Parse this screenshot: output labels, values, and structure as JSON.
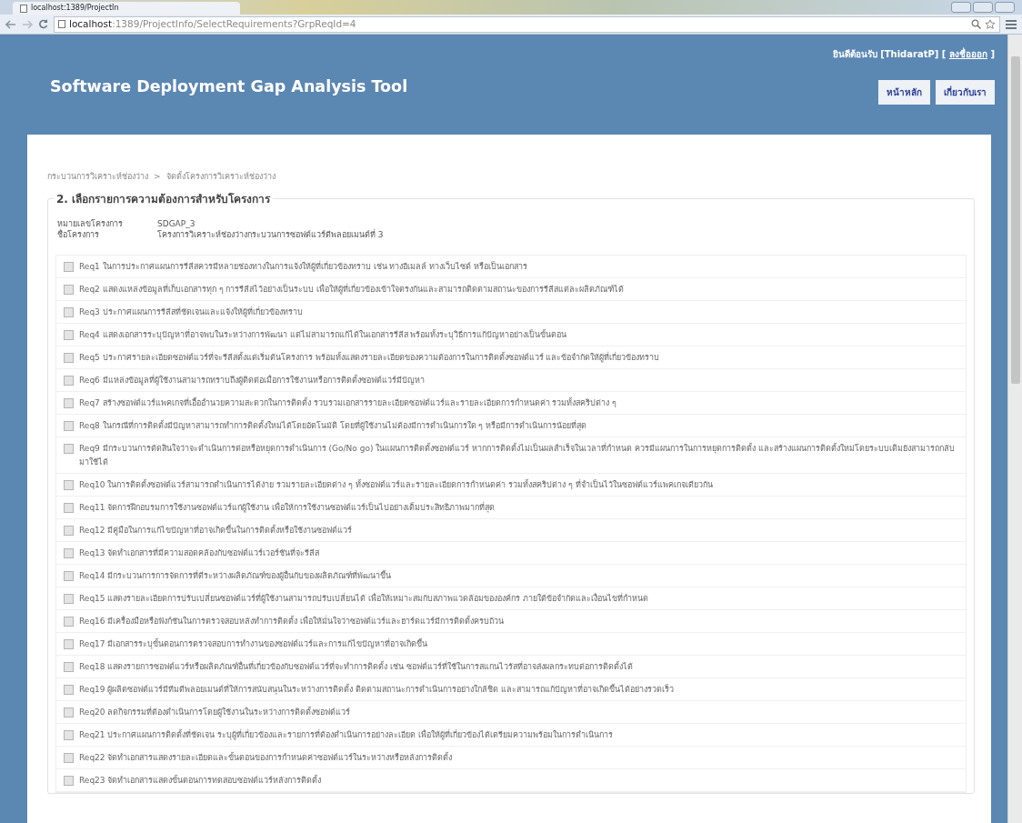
{
  "browser": {
    "tab_title": "localhost:1389/ProjectIn",
    "url_host": "localhost",
    "url_rest": ":1389/ProjectInfo/SelectRequirements?GrpReqId=4"
  },
  "header": {
    "title": "Software Deployment Gap Analysis Tool",
    "welcome": "ยินดีต้อนรับ [ThidaratP] [",
    "logout": "ลงชื่อออก",
    "welcome_end": "]",
    "nav": [
      {
        "label": "หน้าหลัก"
      },
      {
        "label": "เกี่ยวกับเรา"
      }
    ]
  },
  "breadcrumb": [
    "กระบวนการวิเคราะห์ช่องว่าง",
    "จัดตั้งโครงการวิเคราะห์ช่องว่าง"
  ],
  "breadcrumb_separator": ">",
  "section": {
    "legend": "2. เลือกรายการความต้องการสำหรับโครงการ",
    "fields": [
      {
        "label": "หมายเลขโครงการ",
        "value": "SDGAP_3"
      },
      {
        "label": "ชื่อโครงการ",
        "value": "โครงการวิเคราะห์ช่องว่างกระบวนการซอฟต์แวร์ดีพลอยเมนต์ที่ 3"
      }
    ],
    "requirements": [
      {
        "label": "Req1 ในการประกาศแผนการรีลีสควรมีหลายช่องทางในการแจ้งให้ผู้ที่เกี่ยวข้องทราบ เช่น ทางอีเมลล์ ทางเว็บไซต์ หรือเป็นเอกสาร",
        "checked": false
      },
      {
        "label": "Req2 แสดงแหล่งข้อมูลที่เก็บเอกสารทุก ๆ การรีลีสไว้อย่างเป็นระบบ เพื่อให้ผู้ที่เกี่ยวข้องเข้าใจตรงกันและสามารถติดตามสถานะของการรีลีสแต่ละผลิตภัณฑ์ได้",
        "checked": false
      },
      {
        "label": "Req3 ประกาศแผนการรีลีสที่ชัดเจนและแจ้งให้ผู้ที่เกี่ยวข้องทราบ",
        "checked": false
      },
      {
        "label": "Req4 แสดงเอกสารระบุปัญหาที่อาจพบในระหว่างการพัฒนา แต่ไม่สามารถแก้ได้ในเอกสารรีลีส พร้อมทั้งระบุวิธีการแก้ปัญหาอย่างเป็นขั้นตอน",
        "checked": false
      },
      {
        "label": "Req5 ประกาศรายละเอียดซอฟต์แวร์ที่จะรีลีสตั้งแต่เริ่มต้นโครงการ พร้อมทั้งแสดงรายละเอียดของความต้องการในการติดตั้งซอฟต์แวร์ และข้อจำกัดให้ผู้ที่เกี่ยวข้องทราบ",
        "checked": false
      },
      {
        "label": "Req6 มีแหล่งข้อมูลที่ผู้ใช้งานสามารถทราบถึงผู้ติดต่อเมื่อการใช้งานหรือการติดตั้งซอฟต์แวร์มีปัญหา",
        "checked": false
      },
      {
        "label": "Req7 สร้างซอฟต์แวร์แพคเกจที่เอื้ออำนวยความสะดวกในการติดตั้ง รวบรวมเอกสารรายละเอียดซอฟต์แวร์และรายละเอียดการกำหนดค่า รวมทั้งสคริปต่าง ๆ",
        "checked": false
      },
      {
        "label": "Req8 ในกรณีที่การติดตั้งมีปัญหาสามารถทำการติดตั้งใหม่ได้โดยอัตโนมัติ โดยที่ผู้ใช้งานไม่ต้องมีการดำเนินการใด ๆ หรือมีการดำเนินการน้อยที่สุด",
        "checked": false
      },
      {
        "label": "Req9 มีกระบวนการตัดสินใจว่าจะดำเนินการต่อหรือหยุดการดำเนินการ (Go/No go) ในแผนการติดตั้งซอฟต์แวร์ หากการติดตั้งไม่เป็นผลสำเร็จในเวลาที่กำหนด ควรมีแผนการในการหยุดการติดตั้ง และสร้างแผนการติดตั้งใหม่โดยระบบเดิมยังสามารถกลับมาใช้ได้",
        "checked": false
      },
      {
        "label": "Req10 ในการติดตั้งซอฟต์แวร์สามารถดำเนินการได้ง่าย รวมรายละเอียดต่าง ๆ ทั้งซอฟต์แวร์และรายละเอียดการกำหนดค่า รวมทั้งสคริปต่าง ๆ ที่จำเป็นไว้ในซอฟต์แวร์แพคเกจเดียวกัน",
        "checked": false
      },
      {
        "label": "Req11 จัดการฝึกอบรมการใช้งานซอฟต์แวร์แก่ผู้ใช้งาน เพื่อให้การใช้งานซอฟต์แวร์เป็นไปอย่างเต็มประสิทธิภาพมากที่สุด",
        "checked": false
      },
      {
        "label": "Req12 มีคู่มือในการแก้ไขปัญหาที่อาจเกิดขึ้นในการติดตั้งหรือใช้งานซอฟต์แวร์",
        "checked": false
      },
      {
        "label": "Req13 จัดทำเอกสารที่มีความสอดคล้องกับซอฟต์แวร์เวอร์ชันที่จะรีลีส",
        "checked": false
      },
      {
        "label": "Req14 มีกระบวนการการจัดการที่ดีระหว่างผลิตภัณฑ์ของผู้อื่นกับของผลิตภัณฑ์ที่พัฒนาขึ้น",
        "checked": false
      },
      {
        "label": "Req15 แสดงรายละเอียดการปรับเปลี่ยนซอฟต์แวร์ที่ผู้ใช้งานสามารถปรับเปลี่ยนได้ เพื่อให้เหมาะสมกับสภาพแวดล้อมขององค์กร ภายใต้ข้อจำกัดและเงื่อนไขที่กำหนด",
        "checked": false
      },
      {
        "label": "Req16 มีเครื่องมือหรือฟังก์ชันในการตรวจสอบหลังทำการติดตั้ง เพื่อให้มั่นใจว่าซอฟต์แวร์และฮาร์ดแวร์มีการติดตั้งครบถ้วน",
        "checked": false
      },
      {
        "label": "Req17 มีเอกสารระบุขั้นตอนการตรวจสอบการทำงานของซอฟต์แวร์และการแก้ไขปัญหาที่อาจเกิดขึ้น",
        "checked": false
      },
      {
        "label": "Req18 แสดงรายการซอฟต์แวร์หรือผลิตภัณฑ์อื่นที่เกี่ยวข้องกับซอฟต์แวร์ที่จะทำการติดตั้ง เช่น ซอฟต์แวร์ที่ใช้ในการสแกนไวรัสที่อาจส่งผลกระทบต่อการติดตั้งได้",
        "checked": false
      },
      {
        "label": "Req19 ผู้ผลิตซอฟต์แวร์มีทีมดีพลอยเมนต์ที่ให้การสนับสนุนในระหว่างการติดตั้ง ติดตามสถานะการดำเนินการอย่างใกล้ชิด และสามารถแก้ปัญหาที่อาจเกิดขึ้นได้อย่างรวดเร็ว",
        "checked": false
      },
      {
        "label": "Req20 ลดกิจกรรมที่ต้องดำเนินการโดยผู้ใช้งานในระหว่างการติดตั้งซอฟต์แวร์",
        "checked": false
      },
      {
        "label": "Req21 ประกาศแผนการติดตั้งที่ชัดเจน ระบุผู้ที่เกี่ยวข้องและรายการที่ต้องดำเนินการอย่างละเอียด เพื่อให้ผู้ที่เกี่ยวข้องได้เตรียมความพร้อมในการดำเนินการ",
        "checked": false
      },
      {
        "label": "Req22 จัดทำเอกสารแสดงรายละเอียดและขั้นตอนของการกำหนดค่าซอฟต์แวร์ในระหว่างหรือหลังการติดตั้ง",
        "checked": false
      },
      {
        "label": "Req23 จัดทำเอกสารแสดงขั้นตอนการทดสอบซอฟต์แวร์หลังการติดตั้ง",
        "checked": false
      }
    ]
  }
}
